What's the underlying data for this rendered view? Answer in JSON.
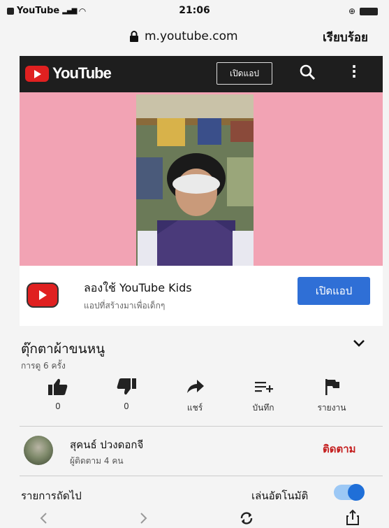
{
  "status_bar": {
    "carrier": "YouTube",
    "time": "21:06"
  },
  "browser": {
    "url": "m.youtube.com",
    "done_label": "เรียบร้อย"
  },
  "header": {
    "logo_text": "YouTube",
    "open_app_label": "เปิดแอป"
  },
  "kids_banner": {
    "title": "ลองใช้ YouTube Kids",
    "subtitle": "แอปที่สร้างมาเพื่อเด็กๆ",
    "button_label": "เปิดแอป"
  },
  "video": {
    "title": "ตุ๊กตาผ้าขนหนู",
    "views": "การดู 6 ครั้ง"
  },
  "actions": [
    {
      "icon": "thumbs-up-icon",
      "label": "0"
    },
    {
      "icon": "thumbs-down-icon",
      "label": "0"
    },
    {
      "icon": "share-icon",
      "label": "แชร์"
    },
    {
      "icon": "save-icon",
      "label": "บันทึก"
    },
    {
      "icon": "flag-icon",
      "label": "รายงาน"
    }
  ],
  "channel": {
    "name": "สุคนธ์ ปวงดอกจี",
    "subscribers": "ผู้ติดตาม 4 คน",
    "follow_label": "ติดตาม"
  },
  "up_next": {
    "label": "รายการถัดไป",
    "autoplay_label": "เล่นอัตโนมัติ",
    "autoplay_on": true
  },
  "colors": {
    "brand_red": "#e02020",
    "blue": "#2f6fd6",
    "video_bg": "#f2a3b4"
  }
}
